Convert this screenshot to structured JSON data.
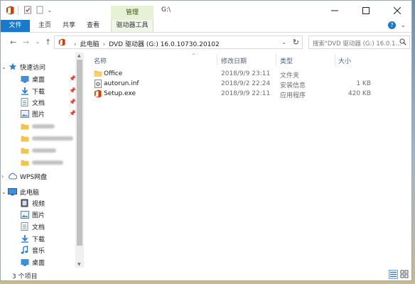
{
  "titlebar": {
    "contextual_tab": "管理",
    "path": "G:\\"
  },
  "ribbon": {
    "tabs": [
      {
        "label": "文件"
      },
      {
        "label": "主页"
      },
      {
        "label": "共享"
      },
      {
        "label": "查看"
      },
      {
        "label": "驱动器工具"
      }
    ]
  },
  "address": {
    "crumbs": [
      "此电脑",
      "DVD 驱动器 (G:) 16.0.10730.20102"
    ],
    "search_placeholder": "搜索\"DVD 驱动器 (G:) 16.0.1..."
  },
  "nav": {
    "quick_access": "快速访问",
    "pinned": [
      {
        "label": "桌面",
        "icon": "desktop-icon"
      },
      {
        "label": "下载",
        "icon": "download-icon"
      },
      {
        "label": "文档",
        "icon": "document-icon"
      },
      {
        "label": "图片",
        "icon": "picture-icon"
      }
    ],
    "wps": "WPS网盘",
    "this_pc": "此电脑",
    "pc_items": [
      {
        "label": "视频",
        "icon": "video-icon"
      },
      {
        "label": "图片",
        "icon": "picture-icon"
      },
      {
        "label": "文档",
        "icon": "document-icon"
      },
      {
        "label": "下载",
        "icon": "download-icon"
      },
      {
        "label": "音乐",
        "icon": "music-icon"
      },
      {
        "label": "桌面",
        "icon": "desktop-icon"
      }
    ]
  },
  "columns": {
    "name": "名称",
    "date": "修改日期",
    "type": "类型",
    "size": "大小"
  },
  "files": [
    {
      "name": "Office",
      "date": "2018/9/9 23:11",
      "type": "文件夹",
      "size": "",
      "icon": "folder-icon"
    },
    {
      "name": "autorun.inf",
      "date": "2018/9/2 22:24",
      "type": "安装信息",
      "size": "1 KB",
      "icon": "settings-file-icon"
    },
    {
      "name": "Setup.exe",
      "date": "2018/9/9 22:11",
      "type": "应用程序",
      "size": "420 KB",
      "icon": "office-setup-icon"
    }
  ],
  "status": {
    "count": "3 个项目"
  },
  "colors": {
    "accent": "#1979ca",
    "folder": "#f1c44d",
    "office": "#d83b01",
    "contextual_tab_bg": "#e6f1d6"
  }
}
